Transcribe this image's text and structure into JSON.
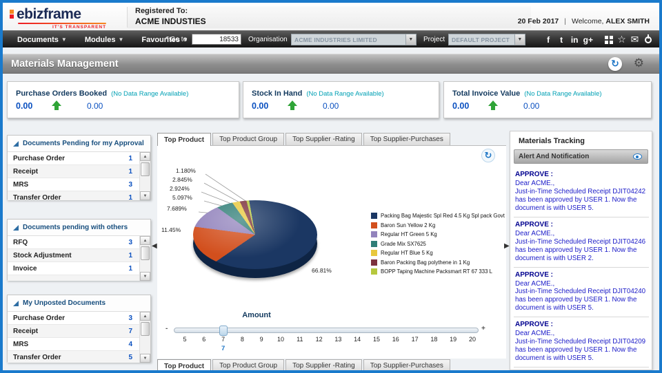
{
  "header": {
    "logo_text": "ebizframe",
    "logo_tagline": "IT'S TRANSPARENT",
    "registered_to_label": "Registered To:",
    "registered_to_value": "ACME INDUSTIES",
    "date": "20 Feb 2017",
    "separator": "|",
    "welcome_label": "Welcome,",
    "user_name": "ALEX SMITH"
  },
  "menubar": {
    "menus": [
      {
        "label": "Documents"
      },
      {
        "label": "Modules"
      },
      {
        "label": "Favourites"
      }
    ],
    "goto_label": "* Go to",
    "goto_value": "18533",
    "organisation_label": "Organisation",
    "organisation_value": "ACME INDUSTRIES LIMITED",
    "project_label": "Project",
    "project_value": "DEFAULT PROJECT",
    "icons": [
      "facebook",
      "twitter",
      "linkedin",
      "googleplus",
      "apps",
      "favourites-star",
      "mail",
      "power"
    ]
  },
  "page": {
    "title": "Materials Management",
    "icons": [
      "refresh",
      "settings-gear"
    ]
  },
  "kpis": [
    {
      "title": "Purchase Orders Booked",
      "note": "(No Data Range Available)",
      "value": "0.00",
      "secondary_value": "0.00"
    },
    {
      "title": "Stock In Hand",
      "note": "(No Data Range Available)",
      "value": "0.00",
      "secondary_value": "0.00"
    },
    {
      "title": "Total Invoice Value",
      "note": "(No Data Range Available)",
      "value": "0.00",
      "secondary_value": "0.00"
    }
  ],
  "left_panels": [
    {
      "title": "Documents Pending for my Approval",
      "rows": [
        {
          "label": "Purchase Order",
          "count": "1"
        },
        {
          "label": "Receipt",
          "count": "1"
        },
        {
          "label": "MRS",
          "count": "3"
        },
        {
          "label": "Transfer Order",
          "count": "1"
        }
      ]
    },
    {
      "title": "Documents pending with others",
      "rows": [
        {
          "label": "RFQ",
          "count": "3"
        },
        {
          "label": "Stock Adjustment",
          "count": "1"
        },
        {
          "label": "Invoice",
          "count": "1"
        },
        {
          "label": ".",
          "count": ""
        }
      ]
    },
    {
      "title": "My Unposted Documents",
      "rows": [
        {
          "label": "Purchase Order",
          "count": "3"
        },
        {
          "label": "Receipt",
          "count": "7"
        },
        {
          "label": "MRS",
          "count": "4"
        },
        {
          "label": "Transfer Order",
          "count": "5"
        }
      ]
    }
  ],
  "center": {
    "tabs": [
      "Top Product",
      "Top Product Group",
      "Top Supplier -Rating",
      "Top Supplier-Purchases"
    ],
    "active_tab_index": 0,
    "amount_label": "Amount",
    "slider": {
      "min_adorner": "-",
      "max_adorner": "+",
      "ticks": [
        "5",
        "6",
        "7",
        "8",
        "9",
        "10",
        "11",
        "12",
        "13",
        "14",
        "15",
        "16",
        "17",
        "18",
        "19",
        "20"
      ],
      "value": "7"
    }
  },
  "chart_data": {
    "type": "pie",
    "is_3d": true,
    "title": "Top Product",
    "value_label": "Amount",
    "labels": [
      "Packing Bag Majestic Spl Red 4.5 Kg Spl pack Govt",
      "Baron Sun Yellow 2 Kg",
      "Regular HT Green 5 Kg",
      "Grade Mix SX7625",
      "Regular HT Blue 5 Kg",
      "Baron Packing Bag polythene in 1 Kg",
      "BOPP Taping Machine Packsmart RT 67 333 L"
    ],
    "values": [
      66.81,
      11.45,
      7.689,
      5.097,
      2.924,
      2.845,
      1.18
    ],
    "pct_labels": [
      "66.81%",
      "11.45%",
      "7.689%",
      "5.097%",
      "2.924%",
      "2.845%",
      "1.180%"
    ],
    "colors": [
      "#1b3763",
      "#d24f1d",
      "#9283bc",
      "#2f7d76",
      "#e8c83d",
      "#7d323d",
      "#b6c83e"
    ],
    "legend_position": "right"
  },
  "right_panel": {
    "title": "Materials Tracking",
    "alert_header": "Alert And Notification",
    "icon": "eye",
    "notifications": [
      {
        "action": "APPROVE :",
        "greeting": "Dear ACME.,",
        "body": "Just-in-Time Scheduled Receipt DJIT04242 has been approved by USER 1. Now the document is with USER 5."
      },
      {
        "action": "APPROVE :",
        "greeting": "Dear ACME.,",
        "body": "Just-in-Time Scheduled Receipt DJIT04246 has been approved by USER 1. Now the document is with USER 2."
      },
      {
        "action": "APPROVE :",
        "greeting": "Dear ACME.,",
        "body": "Just-in-Time Scheduled Receipt DJIT04240 has been approved by USER 1. Now the document is with USER 5."
      },
      {
        "action": "APPROVE :",
        "greeting": "Dear ACME.,",
        "body": "Just-in-Time Scheduled Receipt DJIT04209 has been approved by USER 1. Now the document is with USER 5."
      }
    ]
  }
}
